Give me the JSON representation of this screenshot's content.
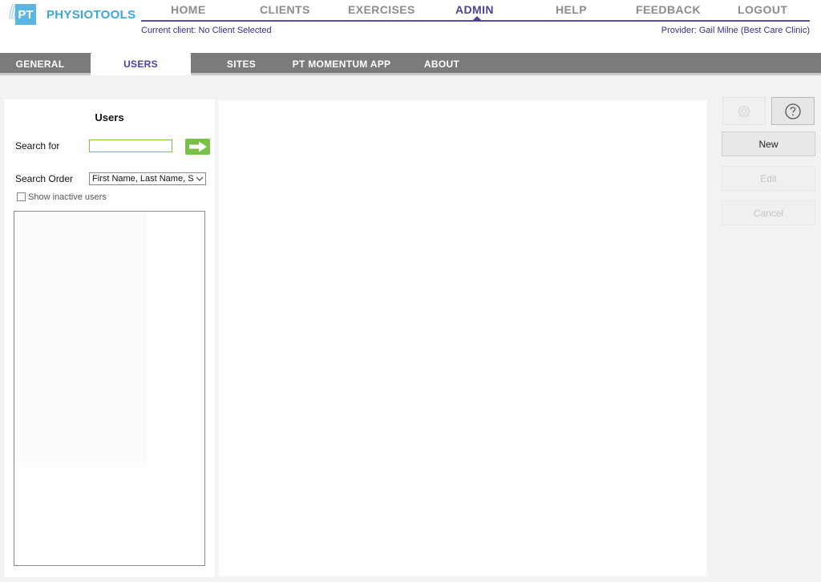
{
  "brand": {
    "logo_initials": "PT",
    "name": "PHYSIOTOOLS",
    "color": "#3aa8d8"
  },
  "main_nav": {
    "items": [
      {
        "label": "HOME",
        "active": false
      },
      {
        "label": "CLIENTS",
        "active": false
      },
      {
        "label": "EXERCISES",
        "active": false
      },
      {
        "label": "ADMIN",
        "active": true
      },
      {
        "label": "HELP",
        "active": false
      },
      {
        "label": "FEEDBACK",
        "active": false
      },
      {
        "label": "LOGOUT",
        "active": false
      }
    ],
    "accent_color": "#4e3f98"
  },
  "status": {
    "current_client": "Current client: No Client Selected",
    "provider": "Provider: Gail Milne (Best Care Clinic)"
  },
  "sub_nav": {
    "items": [
      {
        "label": "GENERAL",
        "active": false
      },
      {
        "label": "USERS",
        "active": true
      },
      {
        "label": "SITES",
        "active": false
      },
      {
        "label": "PT MOMENTUM APP",
        "active": false
      },
      {
        "label": "ABOUT",
        "active": false
      }
    ]
  },
  "users_panel": {
    "title": "Users",
    "search_label": "Search for",
    "search_value": "",
    "order_label": "Search Order",
    "order_value": "First Name, Last Name, Se",
    "inactive_label": "Show inactive users",
    "inactive_checked": false,
    "list_items": []
  },
  "toolbar": {
    "settings_icon": "gear-icon",
    "help_icon": "question-circle-icon"
  },
  "actions": {
    "new_label": "New",
    "edit_label": "Edit",
    "cancel_label": "Cancel",
    "edit_enabled": false,
    "cancel_enabled": false
  }
}
